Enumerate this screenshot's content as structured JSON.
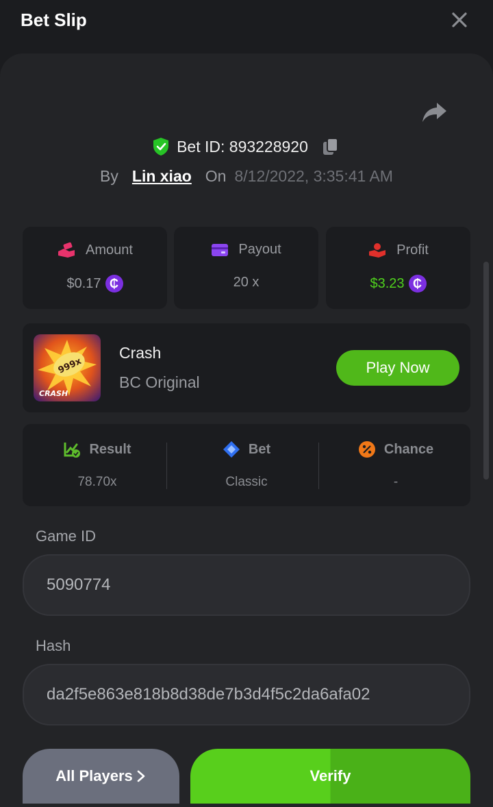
{
  "header": {
    "title": "Bet Slip"
  },
  "bet": {
    "id_text": "Bet ID: 893228920",
    "by_label": "By",
    "user": "Lin xiao",
    "on_label": "On",
    "datetime": "8/12/2022, 3:35:41 AM"
  },
  "stats": [
    {
      "label": "Amount",
      "value": "$0.17",
      "icon": "money-hand-icon",
      "coin": "₵"
    },
    {
      "label": "Payout",
      "value": "20 x",
      "icon": "card-icon"
    },
    {
      "label": "Profit",
      "value": "$3.23",
      "icon": "profit-hand-icon",
      "coin": "₵"
    }
  ],
  "game": {
    "name": "Crash",
    "provider": "BC Original",
    "thumb_badge": "999x",
    "thumb_label": "CRASH",
    "play_label": "Play Now"
  },
  "info": [
    {
      "label": "Result",
      "value": "78.70x",
      "icon": "chart-check-icon"
    },
    {
      "label": "Bet",
      "value": "Classic",
      "icon": "ticket-icon"
    },
    {
      "label": "Chance",
      "value": "-",
      "icon": "percent-icon"
    }
  ],
  "fields": {
    "game_id_label": "Game ID",
    "game_id_value": "5090774",
    "hash_label": "Hash",
    "hash_value": "da2f5e863e818b8d38de7b3d4f5c2da6afa02"
  },
  "actions": {
    "all_players": "All Players",
    "verify": "Verify"
  },
  "colors": {
    "accent_green": "#50b81a",
    "profit_green": "#4fd11d",
    "coin_purple": "#7b2fe0"
  }
}
